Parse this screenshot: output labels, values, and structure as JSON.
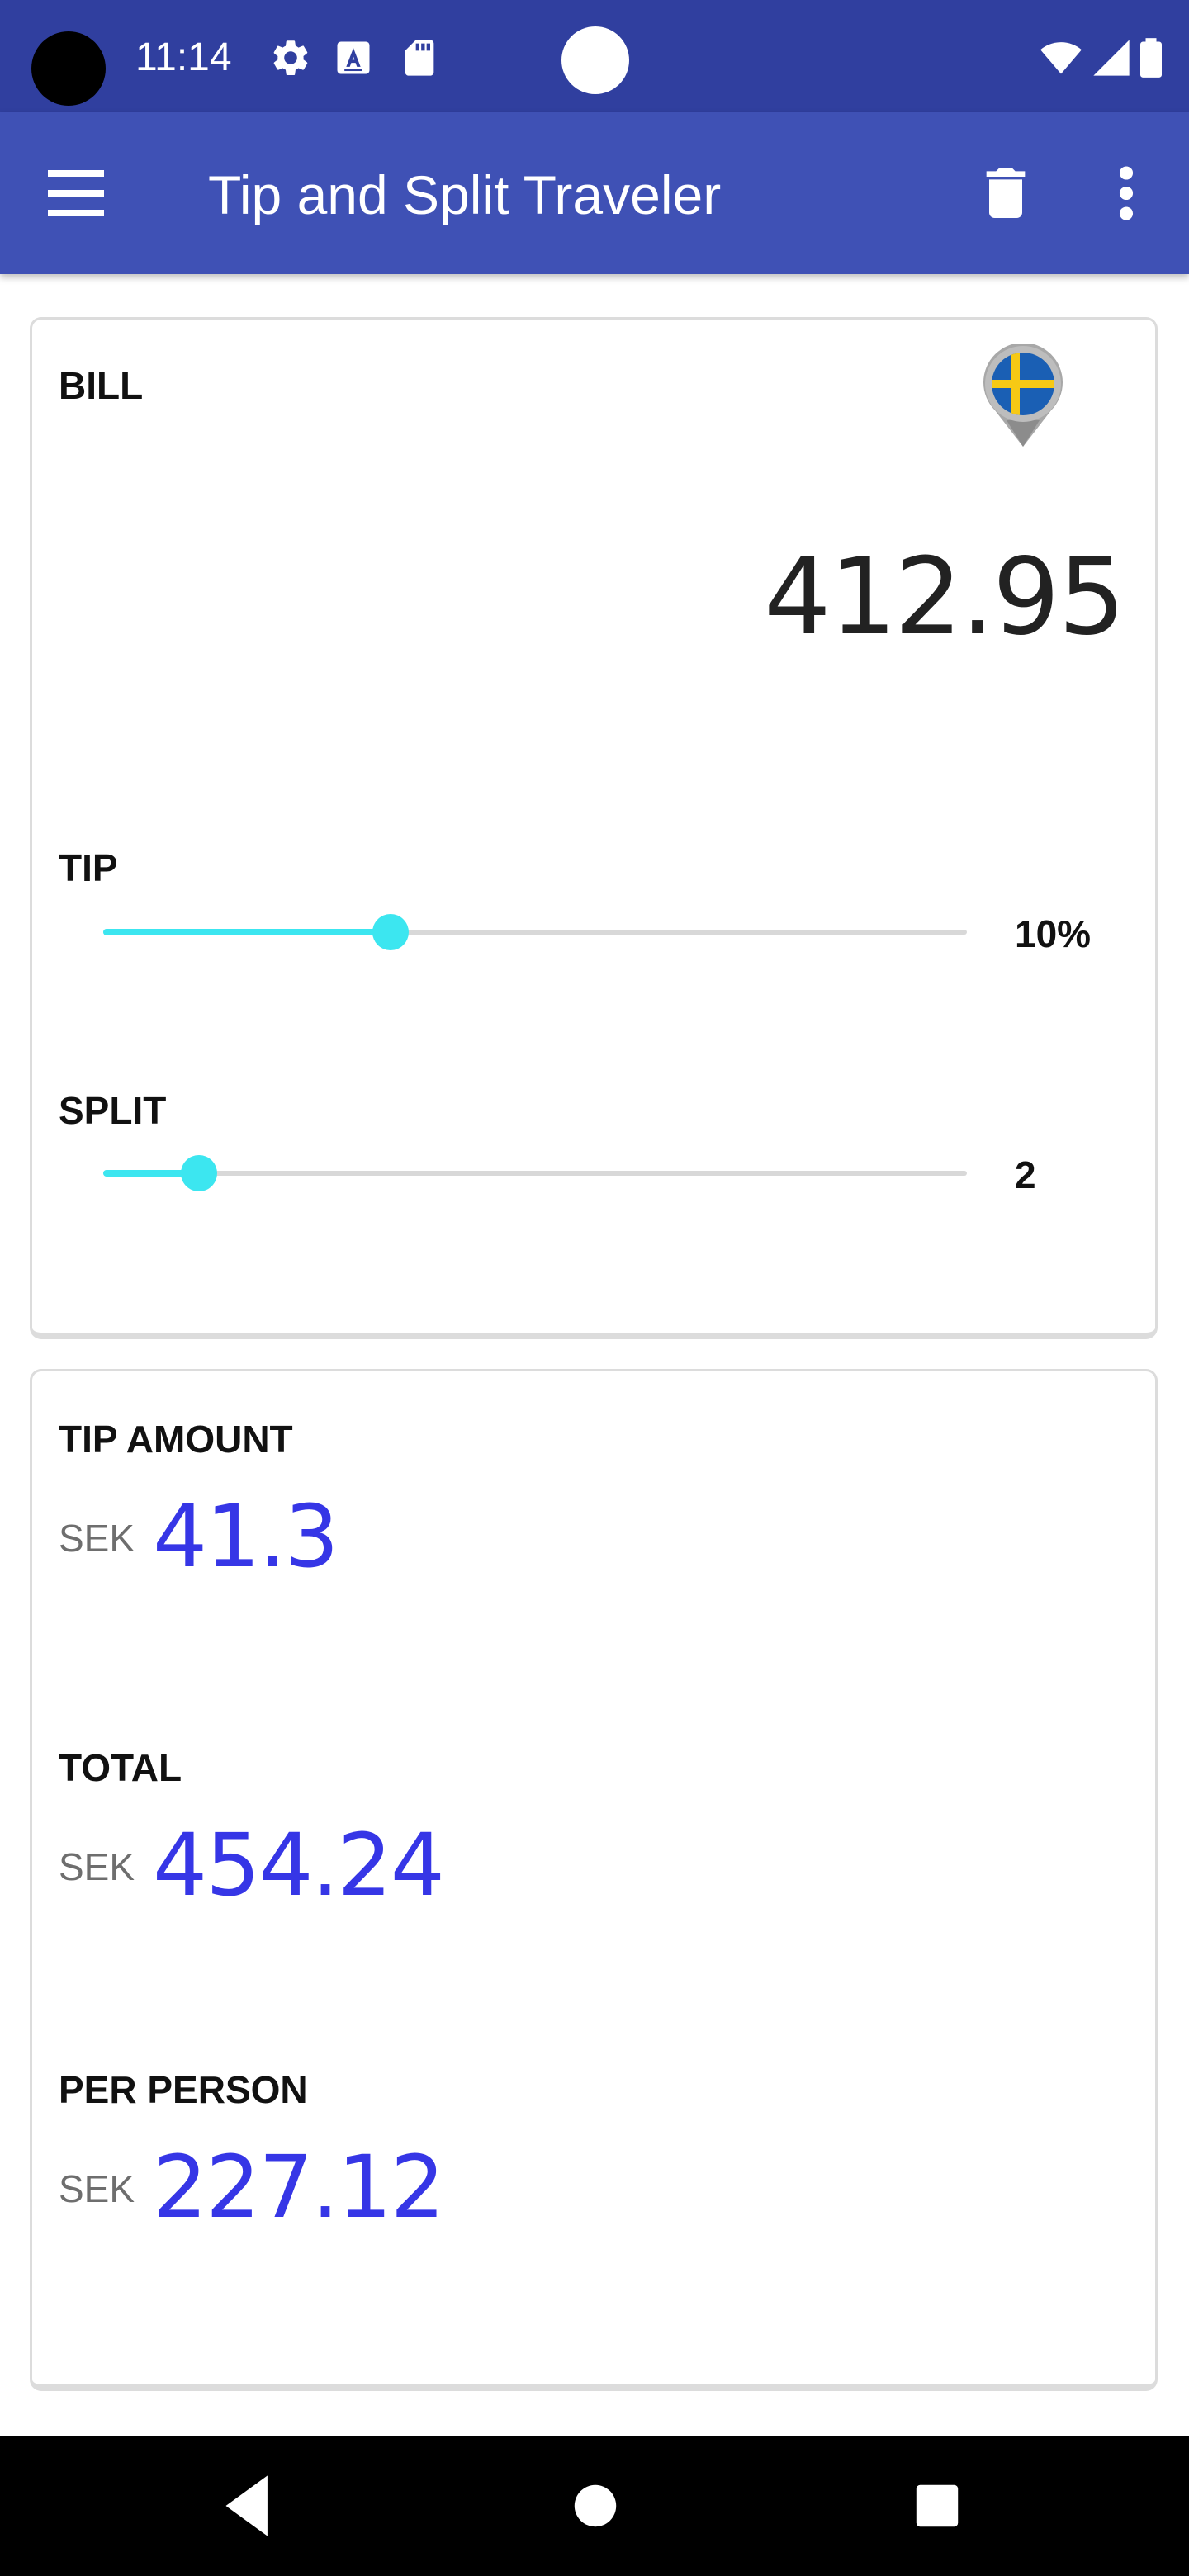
{
  "status_bar": {
    "time": "11:14",
    "icons": [
      "settings-icon",
      "text-a-icon",
      "sd-card-icon",
      "wifi-icon",
      "signal-icon",
      "battery-icon"
    ],
    "bg_color": "#303f9f"
  },
  "app_bar": {
    "title": "Tip and Split Traveler",
    "bg_color": "#3f51b5",
    "icons": [
      "menu-icon",
      "delete-icon",
      "more-vert-icon"
    ]
  },
  "input_card": {
    "bill_label": "BILL",
    "bill_value": "412.95",
    "country_flag": "sweden-flag-icon",
    "tip_label": "TIP",
    "tip_value": "10%",
    "tip_fraction": 0.333,
    "split_label": "SPLIT",
    "split_value": "2",
    "split_fraction": 0.111,
    "slider_color": "#3ce6f0"
  },
  "results_card": {
    "tip_amount_label": "TIP AMOUNT",
    "tip_amount_currency": "SEK",
    "tip_amount_value": "41.3",
    "total_label": "TOTAL",
    "total_currency": "SEK",
    "total_value": "454.24",
    "per_person_label": "PER PERSON",
    "per_person_currency": "SEK",
    "per_person_value": "227.12",
    "amount_color": "#3636e6"
  },
  "nav_bar": {
    "buttons": [
      "back-icon",
      "home-icon",
      "recents-icon"
    ]
  }
}
